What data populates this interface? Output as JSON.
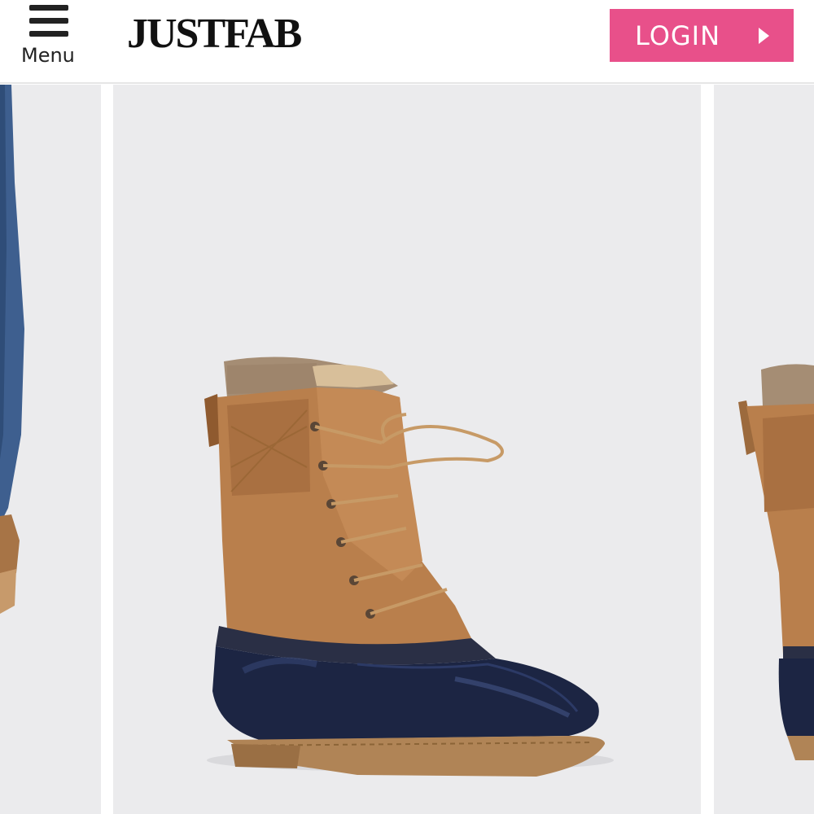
{
  "header": {
    "menu_label": "Menu",
    "logo_text": "JUSTFAB",
    "login_label": "LOGIN"
  },
  "colors": {
    "login_bg": "#e8508a",
    "tile_bg": "#ebebed",
    "boot_tan": "#b97f4c",
    "boot_navy": "#1c2543"
  },
  "icons": {
    "menu": "hamburger-icon",
    "login_arrow": "chevron-right-icon"
  }
}
